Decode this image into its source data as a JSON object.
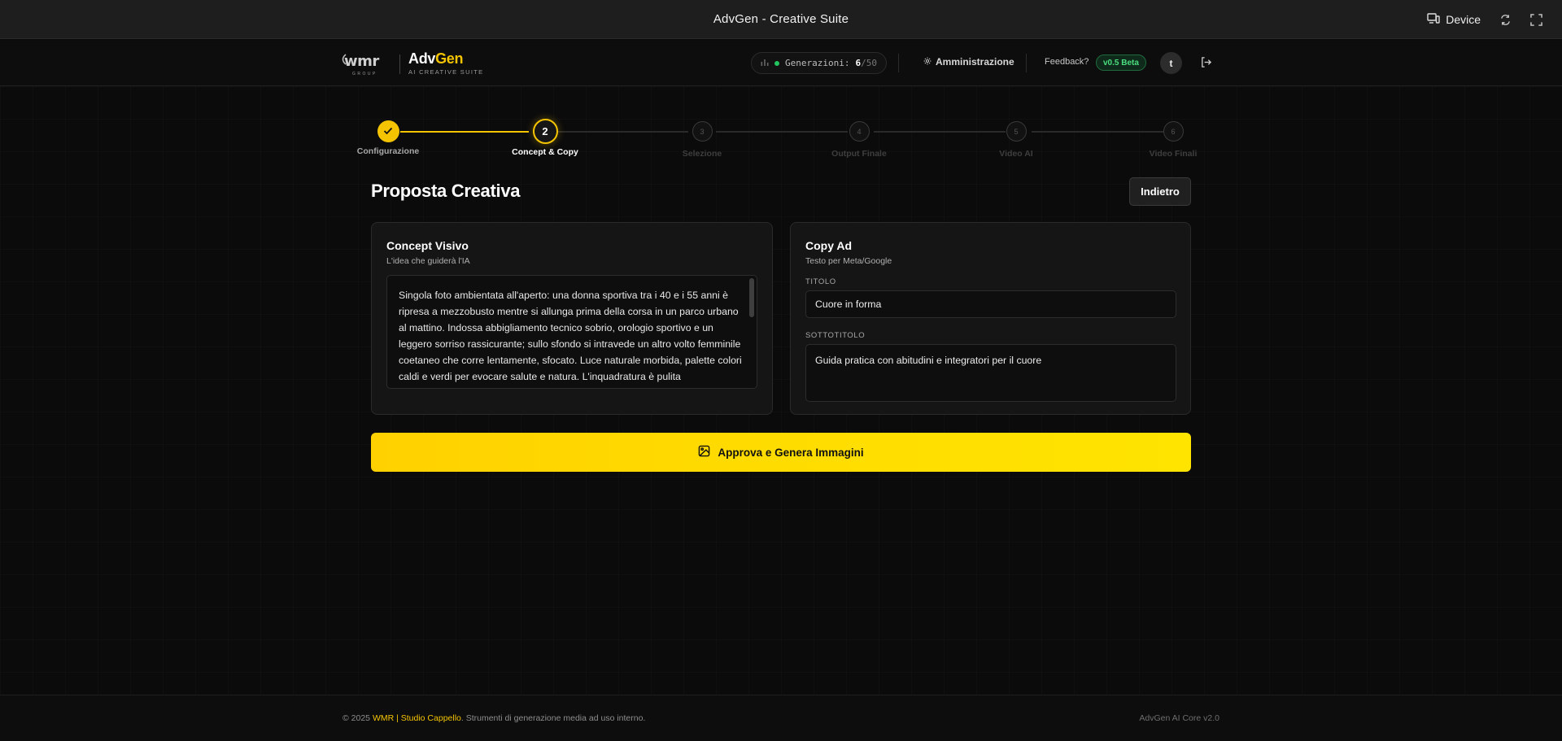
{
  "window": {
    "title": "AdvGen - Creative Suite",
    "device_label": "Device"
  },
  "header": {
    "logo_wmr": "wmr",
    "logo_wmr_sub": "GROUP",
    "brand_adv": "Adv",
    "brand_gen": "Gen",
    "brand_sub": "AI CREATIVE SUITE",
    "generations_label": "Generazioni:",
    "generations_used": "6",
    "generations_total": "/50",
    "admin_label": "Amministrazione",
    "feedback_label": "Feedback?",
    "version_badge": "v0.5 Beta",
    "avatar_initial": "t"
  },
  "stepper": {
    "steps": [
      {
        "number": "1",
        "label": "Configurazione",
        "state": "done"
      },
      {
        "number": "2",
        "label": "Concept & Copy",
        "state": "active"
      },
      {
        "number": "3",
        "label": "Selezione",
        "state": "pending"
      },
      {
        "number": "4",
        "label": "Output Finale",
        "state": "pending"
      },
      {
        "number": "5",
        "label": "Video AI",
        "state": "pending"
      },
      {
        "number": "6",
        "label": "Video Finali",
        "state": "pending"
      }
    ]
  },
  "main": {
    "title": "Proposta Creativa",
    "back_button": "Indietro",
    "concept": {
      "title": "Concept Visivo",
      "subtitle": "L'idea che guiderà l'IA",
      "text": "Singola foto ambientata all'aperto: una donna sportiva tra i 40 e i 55 anni è ripresa a mezzobusto mentre si allunga prima della corsa in un parco urbano al mattino. Indossa abbigliamento tecnico sobrio, orologio sportivo e un leggero sorriso rassicurante; sullo sfondo si intravede un altro volto femminile coetaneo che corre lentamente, sfocato. Luce naturale morbida, palette colori caldi e verdi per evocare salute e natura. L'inquadratura è pulita"
    },
    "copy": {
      "title": "Copy Ad",
      "subtitle": "Testo per Meta/Google",
      "title_label": "TITOLO",
      "title_value": "Cuore in forma",
      "subtitle_label": "SOTTOTITOLO",
      "subtitle_value": "Guida pratica con abitudini e integratori per il cuore"
    },
    "approve_button": "Approva e Genera Immagini"
  },
  "footer": {
    "copyright_prefix": "© 2025",
    "company": "WMR | Studio Cappello",
    "copyright_suffix": ". Strumenti di generazione media ad uso interno.",
    "core_version": "AdvGen AI Core v2.0"
  },
  "colors": {
    "accent": "#f5c400",
    "background": "#0b0b0c",
    "card": "#151516",
    "status_green": "#22c55e"
  }
}
